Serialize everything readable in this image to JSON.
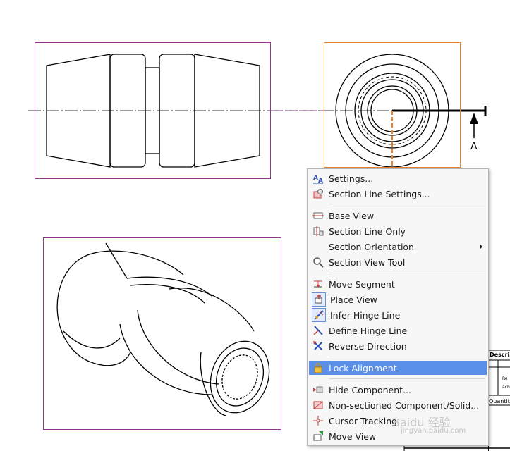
{
  "drawing": {
    "section_label": "A"
  },
  "title_block": {
    "header": "Descrip",
    "cells": [
      "Re",
      "ach",
      "Quantity"
    ]
  },
  "context_menu": {
    "items": [
      {
        "label": "Settings...",
        "icon": "settings-font-icon"
      },
      {
        "label": "Section Line Settings...",
        "icon": "section-line-settings-icon"
      },
      {
        "label": "Base View",
        "icon": "base-view-icon"
      },
      {
        "label": "Section Line Only",
        "icon": "section-line-only-icon"
      },
      {
        "label": "Section Orientation",
        "icon": "none",
        "submenu": true
      },
      {
        "label": "Section View Tool",
        "icon": "magnifier-icon"
      },
      {
        "label": "Move Segment",
        "icon": "move-segment-icon"
      },
      {
        "label": "Place View",
        "icon": "place-view-icon"
      },
      {
        "label": "Infer Hinge Line",
        "icon": "infer-hinge-icon"
      },
      {
        "label": "Define Hinge Line",
        "icon": "define-hinge-icon"
      },
      {
        "label": "Reverse Direction",
        "icon": "reverse-direction-icon"
      },
      {
        "label": "Lock Alignment",
        "icon": "lock-icon",
        "selected": true
      },
      {
        "label": "Hide Component...",
        "icon": "hide-component-icon"
      },
      {
        "label": "Non-sectioned Component/Solid...",
        "icon": "non-sectioned-icon"
      },
      {
        "label": "Cursor Tracking",
        "icon": "cursor-tracking-icon"
      },
      {
        "label": "Move View",
        "icon": "move-view-icon"
      }
    ]
  },
  "watermark": {
    "text": "Baidu 经验",
    "sub": "jingyan.baidu.com"
  },
  "colors": {
    "view_border": "#8a3b8a",
    "selected_view": "#f08020",
    "menu_highlight": "#5a8fe8"
  }
}
